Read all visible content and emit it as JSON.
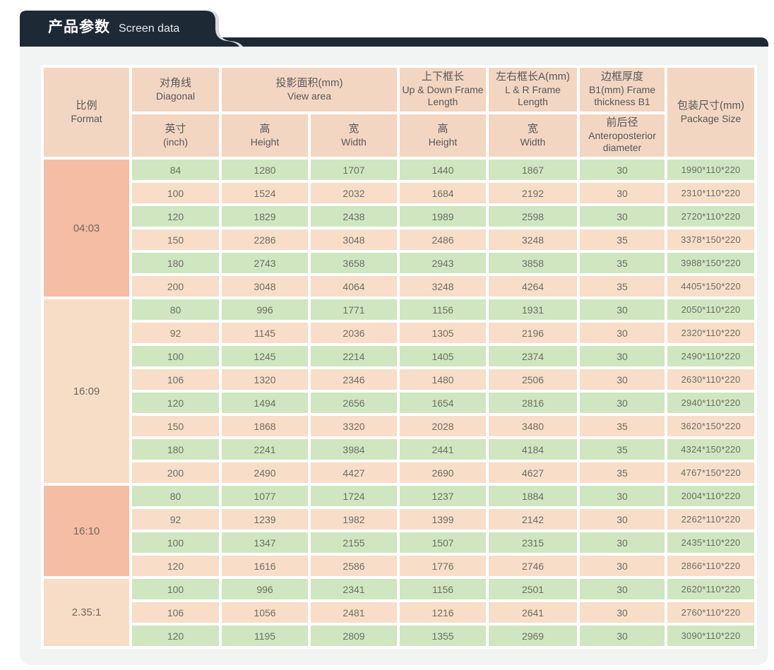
{
  "banner": {
    "title_zh": "产品参数",
    "title_en": "Screen data"
  },
  "colors": {
    "banner_bg": "#1e2936",
    "tab_outline": "#d8dadc",
    "panel_bg": "#f2f3f3",
    "header_cell": "#f3d6c1",
    "row_green": "#cfe6c0",
    "row_peach": "#f8ddc8",
    "format_dark": "#f4bda4",
    "format_light": "#f7dcc6",
    "data_text": "#6e6e64",
    "header_text": "#57585c"
  },
  "table": {
    "header": {
      "format_zh": "比例",
      "format_en": "Format",
      "diagonal_zh": "对角线",
      "diagonal_en": "Diagonal",
      "diagonal_sub_zh": "英寸",
      "diagonal_sub_en": "(inch)",
      "view_zh": "投影面积(mm)",
      "view_en": "View area",
      "view_h_zh": "高",
      "view_h_en": "Height",
      "view_w_zh": "宽",
      "view_w_en": "Width",
      "ud_zh": "上下框长",
      "ud_en": "Up & Down Frame Length",
      "ud_h_zh": "高",
      "ud_h_en": "Height",
      "lr_zh": "左右框长A(mm)",
      "lr_en": "L & R  Frame Length",
      "lr_w_zh": "宽",
      "lr_w_en": "Width",
      "b1_zh": "边框厚度",
      "b1_en": "B1(mm) Frame thickness B1",
      "b1_sub_zh": "前后径",
      "b1_sub_en": "Anteroposterior diameter",
      "pkg_zh": "包装尺寸(mm)",
      "pkg_en": "Package Size"
    },
    "groups": [
      {
        "format": "04:03",
        "shade": "dark",
        "rows": [
          [
            "84",
            "1280",
            "1707",
            "1440",
            "1867",
            "30",
            "1990*110*220"
          ],
          [
            "100",
            "1524",
            "2032",
            "1684",
            "2192",
            "30",
            "2310*110*220"
          ],
          [
            "120",
            "1829",
            "2438",
            "1989",
            "2598",
            "30",
            "2720*110*220"
          ],
          [
            "150",
            "2286",
            "3048",
            "2486",
            "3248",
            "35",
            "3378*150*220"
          ],
          [
            "180",
            "2743",
            "3658",
            "2943",
            "3858",
            "35",
            "3988*150*220"
          ],
          [
            "200",
            "3048",
            "4064",
            "3248",
            "4264",
            "35",
            "4405*150*220"
          ]
        ]
      },
      {
        "format": "16:09",
        "shade": "light",
        "rows": [
          [
            "80",
            "996",
            "1771",
            "1156",
            "1931",
            "30",
            "2050*110*220"
          ],
          [
            "92",
            "1145",
            "2036",
            "1305",
            "2196",
            "30",
            "2320*110*220"
          ],
          [
            "100",
            "1245",
            "2214",
            "1405",
            "2374",
            "30",
            "2490*110*220"
          ],
          [
            "106",
            "1320",
            "2346",
            "1480",
            "2506",
            "30",
            "2630*110*220"
          ],
          [
            "120",
            "1494",
            "2656",
            "1654",
            "2816",
            "30",
            "2940*110*220"
          ],
          [
            "150",
            "1868",
            "3320",
            "2028",
            "3480",
            "35",
            "3620*150*220"
          ],
          [
            "180",
            "2241",
            "3984",
            "2441",
            "4184",
            "35",
            "4324*150*220"
          ],
          [
            "200",
            "2490",
            "4427",
            "2690",
            "4627",
            "35",
            "4767*150*220"
          ]
        ]
      },
      {
        "format": "16:10",
        "shade": "dark",
        "rows": [
          [
            "80",
            "1077",
            "1724",
            "1237",
            "1884",
            "30",
            "2004*110*220"
          ],
          [
            "92",
            "1239",
            "1982",
            "1399",
            "2142",
            "30",
            "2262*110*220"
          ],
          [
            "100",
            "1347",
            "2155",
            "1507",
            "2315",
            "30",
            "2435*110*220"
          ],
          [
            "120",
            "1616",
            "2586",
            "1776",
            "2746",
            "30",
            "2866*110*220"
          ]
        ]
      },
      {
        "format": "2.35:1",
        "shade": "light",
        "rows": [
          [
            "100",
            "996",
            "2341",
            "1156",
            "2501",
            "30",
            "2620*110*220"
          ],
          [
            "106",
            "1056",
            "2481",
            "1216",
            "2641",
            "30",
            "2760*110*220"
          ],
          [
            "120",
            "1195",
            "2809",
            "1355",
            "2969",
            "30",
            "3090*110*220"
          ]
        ]
      }
    ]
  }
}
